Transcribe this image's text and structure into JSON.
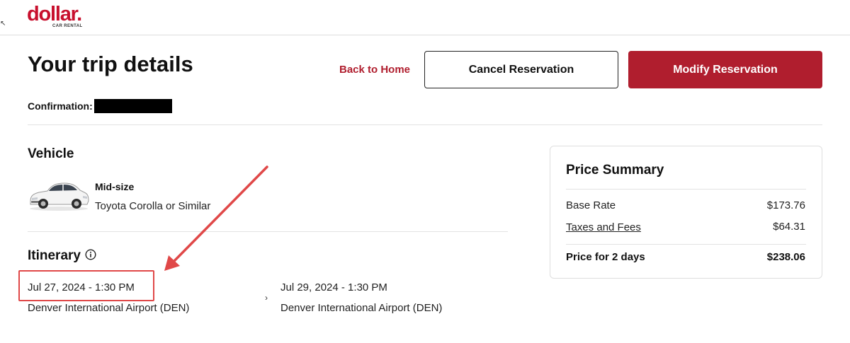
{
  "header": {
    "brand": "dollar",
    "brand_dot": ".",
    "brand_sub": "CAR RENTAL"
  },
  "title": {
    "heading": "Your trip details",
    "back_link": "Back to Home",
    "cancel_label": "Cancel Reservation",
    "modify_label": "Modify Reservation"
  },
  "confirmation": {
    "label": "Confirmation:"
  },
  "vehicle": {
    "heading": "Vehicle",
    "class": "Mid-size",
    "model": "Toyota Corolla or Similar"
  },
  "itinerary": {
    "heading": "Itinerary",
    "info_icon": "info-icon",
    "pickup": {
      "datetime": "Jul 27, 2024 - 1:30 PM",
      "location": "Denver International Airport (DEN)"
    },
    "separator": "›",
    "dropoff": {
      "datetime": "Jul 29, 2024 - 1:30 PM",
      "location": "Denver International Airport (DEN)"
    }
  },
  "price_summary": {
    "title": "Price Summary",
    "base_rate_label": "Base Rate",
    "base_rate_value": "$173.76",
    "taxes_label": "Taxes and Fees",
    "taxes_value": "$64.31",
    "total_label": "Price for 2 days",
    "total_value": "$238.06"
  },
  "colors": {
    "brand_red": "#c8102e",
    "button_red": "#b01e2e",
    "annotation_red": "#e04848"
  }
}
